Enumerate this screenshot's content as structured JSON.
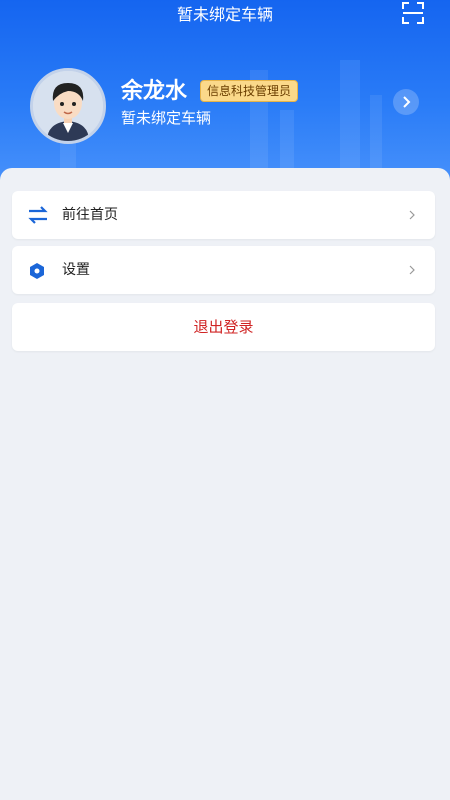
{
  "header": {
    "title": "暂未绑定车辆",
    "scan_icon": "scan-icon",
    "gradient_top": "#1565f0",
    "gradient_bottom": "#4a93fb"
  },
  "profile": {
    "name": "余龙水",
    "role": "信息科技管理员",
    "vehicle_status": "暂未绑定车辆",
    "avatar_icon": "cartoon-boy-avatar",
    "go_icon": "chevron-right-icon"
  },
  "menu": {
    "items": [
      {
        "label": "前往首页",
        "icon": "swap-arrows-icon"
      },
      {
        "label": "设置",
        "icon": "hexagon-settings-icon"
      }
    ]
  },
  "logout": {
    "label": "退出登录",
    "color": "#d02424"
  }
}
